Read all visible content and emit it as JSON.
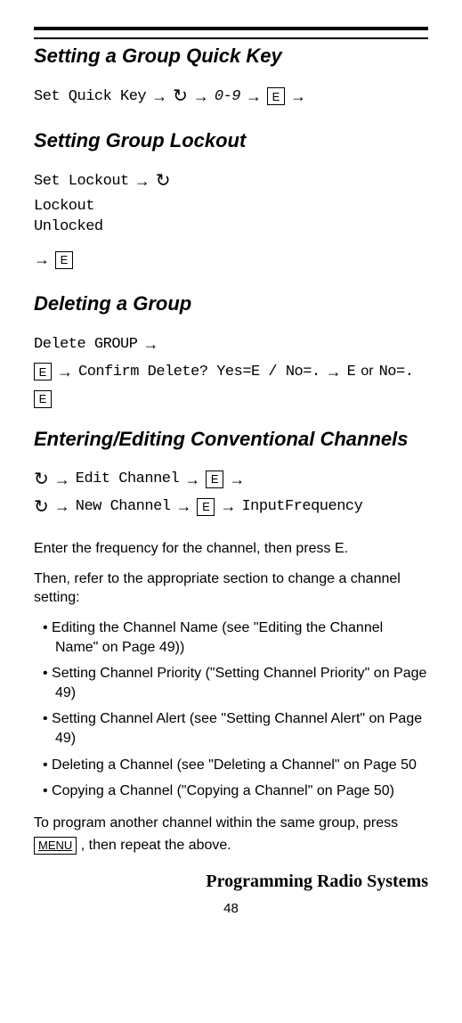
{
  "sections": {
    "quickKey": {
      "heading": "Setting a Group Quick Key",
      "label": "Set Quick Key",
      "digits": "0-9",
      "eKey": "E"
    },
    "lockout": {
      "heading": "Setting Group Lockout",
      "label": "Set Lockout",
      "opt1": "Lockout",
      "opt2": "Unlocked",
      "eKey": "E"
    },
    "deleteGroup": {
      "heading": "Deleting a Group",
      "label": "Delete GROUP",
      "eKey": "E",
      "confirm": "Confirm Delete? Yes=E / No=.",
      "yesKey": "E",
      "orText": "or",
      "noText": "No=.",
      "eKey2": "E"
    },
    "editChannels": {
      "heading": "Entering/Editing Conventional Channels",
      "editChannel": "Edit Channel",
      "newChannel": "New Channel",
      "inputFreq": "InputFrequency",
      "eKey": "E",
      "body1": "Enter the frequency for the channel, then press E.",
      "body2": "Then, refer to the appropriate section to change a channel setting:",
      "bullets": [
        "Editing the Channel Name (see \"Editing the Channel Name\" on Page 49))",
        "Setting Channel Priority (\"Setting Channel Priority\" on Page 49)",
        "Setting Channel Alert (see \"Setting Channel Alert\" on Page 49)",
        "Deleting a Channel (see \"Deleting a Channel\" on Page 50",
        "Copying a Channel (\"Copying a Channel\" on Page 50)"
      ],
      "body3a": "To program another channel within the same group, press ",
      "menuKey": "MENU",
      "body3b": " , then repeat the above."
    }
  },
  "footer": {
    "title": "Programming Radio Systems",
    "page": "48"
  },
  "glyphs": {
    "arrow": "→",
    "scroll": "↻"
  }
}
